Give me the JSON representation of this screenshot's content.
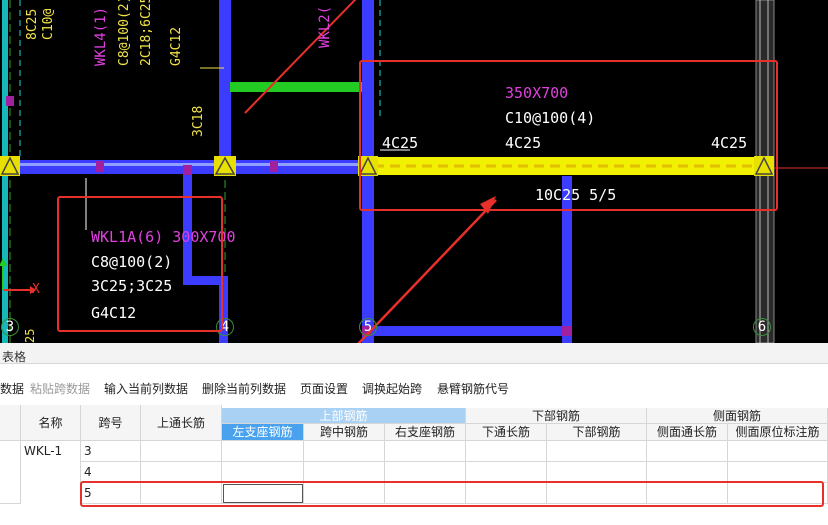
{
  "drawing": {
    "tags_left": [
      "8C25",
      "C10@"
    ],
    "wkl4": "WKL4(1) 3",
    "stirrup_2": "C8@100(2)",
    "bars_2c18": "2C18;6C25",
    "g4c12_top": "G4C12",
    "wkl2": "WKL2(",
    "v_3c18": "3C18",
    "annotation_beam": {
      "section": "350X700",
      "stirrup": "C10@100(4)",
      "left_top": "4C25",
      "mid_top": "4C25",
      "right_top": "4C25",
      "bottom": "10C25 5/5"
    },
    "wkl1a": {
      "name": "WKL1A(6) 300X700",
      "stirrup": "C8@100(2)",
      "bars": "3C25;3C25",
      "side": "G4C12"
    },
    "axis_x": "X",
    "bottom_25": "25",
    "grid_labels": [
      "3",
      "4",
      "5",
      "6"
    ],
    "colors": {
      "beam": "#3c3cff",
      "highlight": "#f0f000",
      "green": "#22cc22",
      "annotation": "#e8302a"
    }
  },
  "panel": {
    "title": "表格",
    "toolbar": {
      "item_0": "数据",
      "paste": "粘贴跨数据",
      "insert": "输入当前列数据",
      "delete": "删除当前列数据",
      "page": "页面设置",
      "swap": "调换起始跨",
      "cantilever": "悬臂钢筋代号"
    },
    "grid": {
      "col_name": "名称",
      "col_span": "跨号",
      "col_top_through": "上通长筋",
      "group_top": "上部钢筋",
      "group_bottom": "下部钢筋",
      "group_side": "侧面钢筋",
      "sub_left_support": "左支座钢筋",
      "sub_mid_span": "跨中钢筋",
      "sub_right_support": "右支座钢筋",
      "sub_bottom_through": "下通长筋",
      "sub_bottom": "下部钢筋",
      "sub_side_through": "侧面通长筋",
      "sub_side_mark": "侧面原位标注筋",
      "rows": [
        {
          "name": "WKL-1",
          "span": "3"
        },
        {
          "name": "",
          "span": "4"
        },
        {
          "name": "",
          "span": "5"
        }
      ]
    }
  }
}
